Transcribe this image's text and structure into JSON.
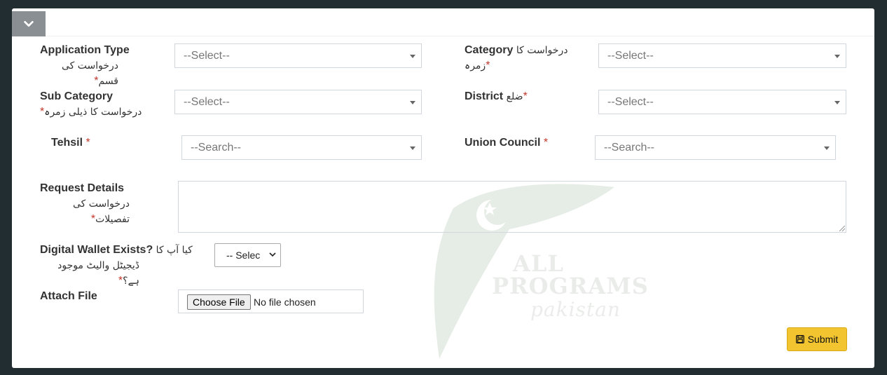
{
  "form": {
    "application_type": {
      "label": "Application Type",
      "urdu": "درخواست کی قسم",
      "required": "*",
      "placeholder": "--Select--"
    },
    "category": {
      "label": "Category",
      "urdu": "درخواست کا زمرہ",
      "required": "*",
      "placeholder": "--Select--"
    },
    "sub_category": {
      "label": "Sub Category",
      "urdu": "درخواست کا ذیلی زمرہ",
      "required": "*",
      "placeholder": "--Select--"
    },
    "district": {
      "label": "District",
      "urdu": "ضلع",
      "required": "*",
      "placeholder": "--Select--"
    },
    "tehsil": {
      "label": "Tehsil",
      "required": "*",
      "placeholder": "--Search--"
    },
    "union_council": {
      "label": "Union Council",
      "required": "*",
      "placeholder": "--Search--"
    },
    "request_details": {
      "label": "Request Details",
      "urdu": "درخواست کی تفصیلات",
      "required": "*"
    },
    "digital_wallet": {
      "label": "Digital Wallet Exists?",
      "urdu_1": "کیا آپ کا",
      "urdu_2": "ڈیجیٹل والیٹ موجود ہے؟",
      "required": "*",
      "selected": "-- Selec"
    },
    "attach_file": {
      "label": "Attach File",
      "button": "Choose File",
      "status": "No file chosen"
    },
    "submit_label": "Submit"
  },
  "watermark": {
    "line1": "ALL",
    "line2": "PROGRAMS",
    "line3": "pakistan"
  },
  "colors": {
    "background": "#222d32",
    "collapse_button": "#8a8f93",
    "submit": "#f2c530",
    "required": "#c0392b"
  }
}
